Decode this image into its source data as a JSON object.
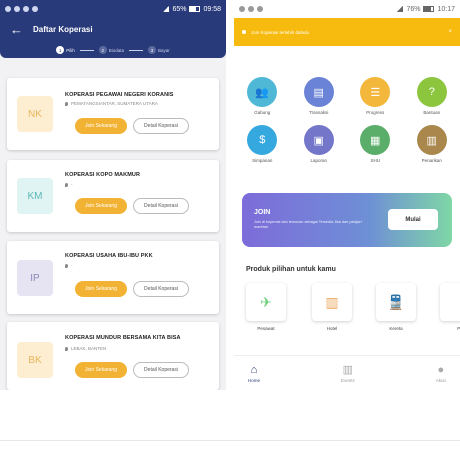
{
  "left_phone": {
    "status": {
      "battery": "65%",
      "time": "09:58"
    },
    "title": "Daftar Koperasi",
    "steps": [
      {
        "num": "1",
        "label": "Pilih"
      },
      {
        "num": "2",
        "label": "Biodata"
      },
      {
        "num": "3",
        "label": "Bayar"
      }
    ],
    "cards": [
      {
        "initials": "NK",
        "name": "KOPERASI PEGAWAI NEGERI KORANIS",
        "location": "PEMATANGSIANTAR, SUMATERA UTARA",
        "join": "Join Sekarang",
        "detail": "Detail Koperasi"
      },
      {
        "initials": "KM",
        "name": "KOPERASI KOPO MAKMUR",
        "location": "-",
        "join": "Join Sekarang",
        "detail": "Detail Koperasi"
      },
      {
        "initials": "IP",
        "name": "KOPERASI USAHA IBU-IBU PKK",
        "location": "-",
        "join": "Join Sekarang",
        "detail": "Detail Koperasi"
      },
      {
        "initials": "BK",
        "name": "KOPERASI MUNDUR BERSAMA KITA BISA",
        "location": "LEBAK, BANTEN",
        "join": "Join Sekarang",
        "detail": "Detail Koperasi"
      }
    ]
  },
  "right_phone": {
    "status": {
      "battery": "76%",
      "time": "10:17"
    },
    "notice": "Join Koperasi terlebih dahulu",
    "close": "×",
    "menu": [
      {
        "label": "Gabung",
        "icon": "people-icon",
        "color": "#4fb8d6"
      },
      {
        "label": "Transaksi",
        "icon": "list-icon",
        "color": "#6b83d6"
      },
      {
        "label": "Progress",
        "icon": "list-icon",
        "color": "#f3b83b"
      },
      {
        "label": "Bantuan",
        "icon": "help-icon",
        "color": "#8cc63f"
      },
      {
        "label": "Simpanan",
        "icon": "money-icon",
        "color": "#36a8e0"
      },
      {
        "label": "Laporan",
        "icon": "report-icon",
        "color": "#7477c9"
      },
      {
        "label": "SHU",
        "icon": "chart-icon",
        "color": "#5bae6a"
      },
      {
        "label": "Penarikan",
        "icon": "wallet-icon",
        "color": "#a9874d"
      }
    ],
    "banner": {
      "title": "JOIN",
      "desc": "Join di koperasi dan temukan sebagai Tersedia Jika dan pelajari manfaat.",
      "button": "Mulai"
    },
    "products_title": "Produk pilihan untuk kamu",
    "products": [
      {
        "label": "Pesawat",
        "icon": "plane-icon"
      },
      {
        "label": "Hotel",
        "icon": "hotel-icon"
      },
      {
        "label": "Kereta",
        "icon": "train-icon"
      },
      {
        "label": "Pu",
        "icon": "more-icon"
      }
    ],
    "nav": [
      {
        "label": "Home",
        "icon": "home-icon"
      },
      {
        "label": "Events",
        "icon": "events-icon"
      },
      {
        "label": "Akun",
        "icon": "user-icon"
      }
    ]
  },
  "colors": {
    "primary": "#293a7a",
    "accent": "#f2b233",
    "notice": "#f6bb0e"
  }
}
